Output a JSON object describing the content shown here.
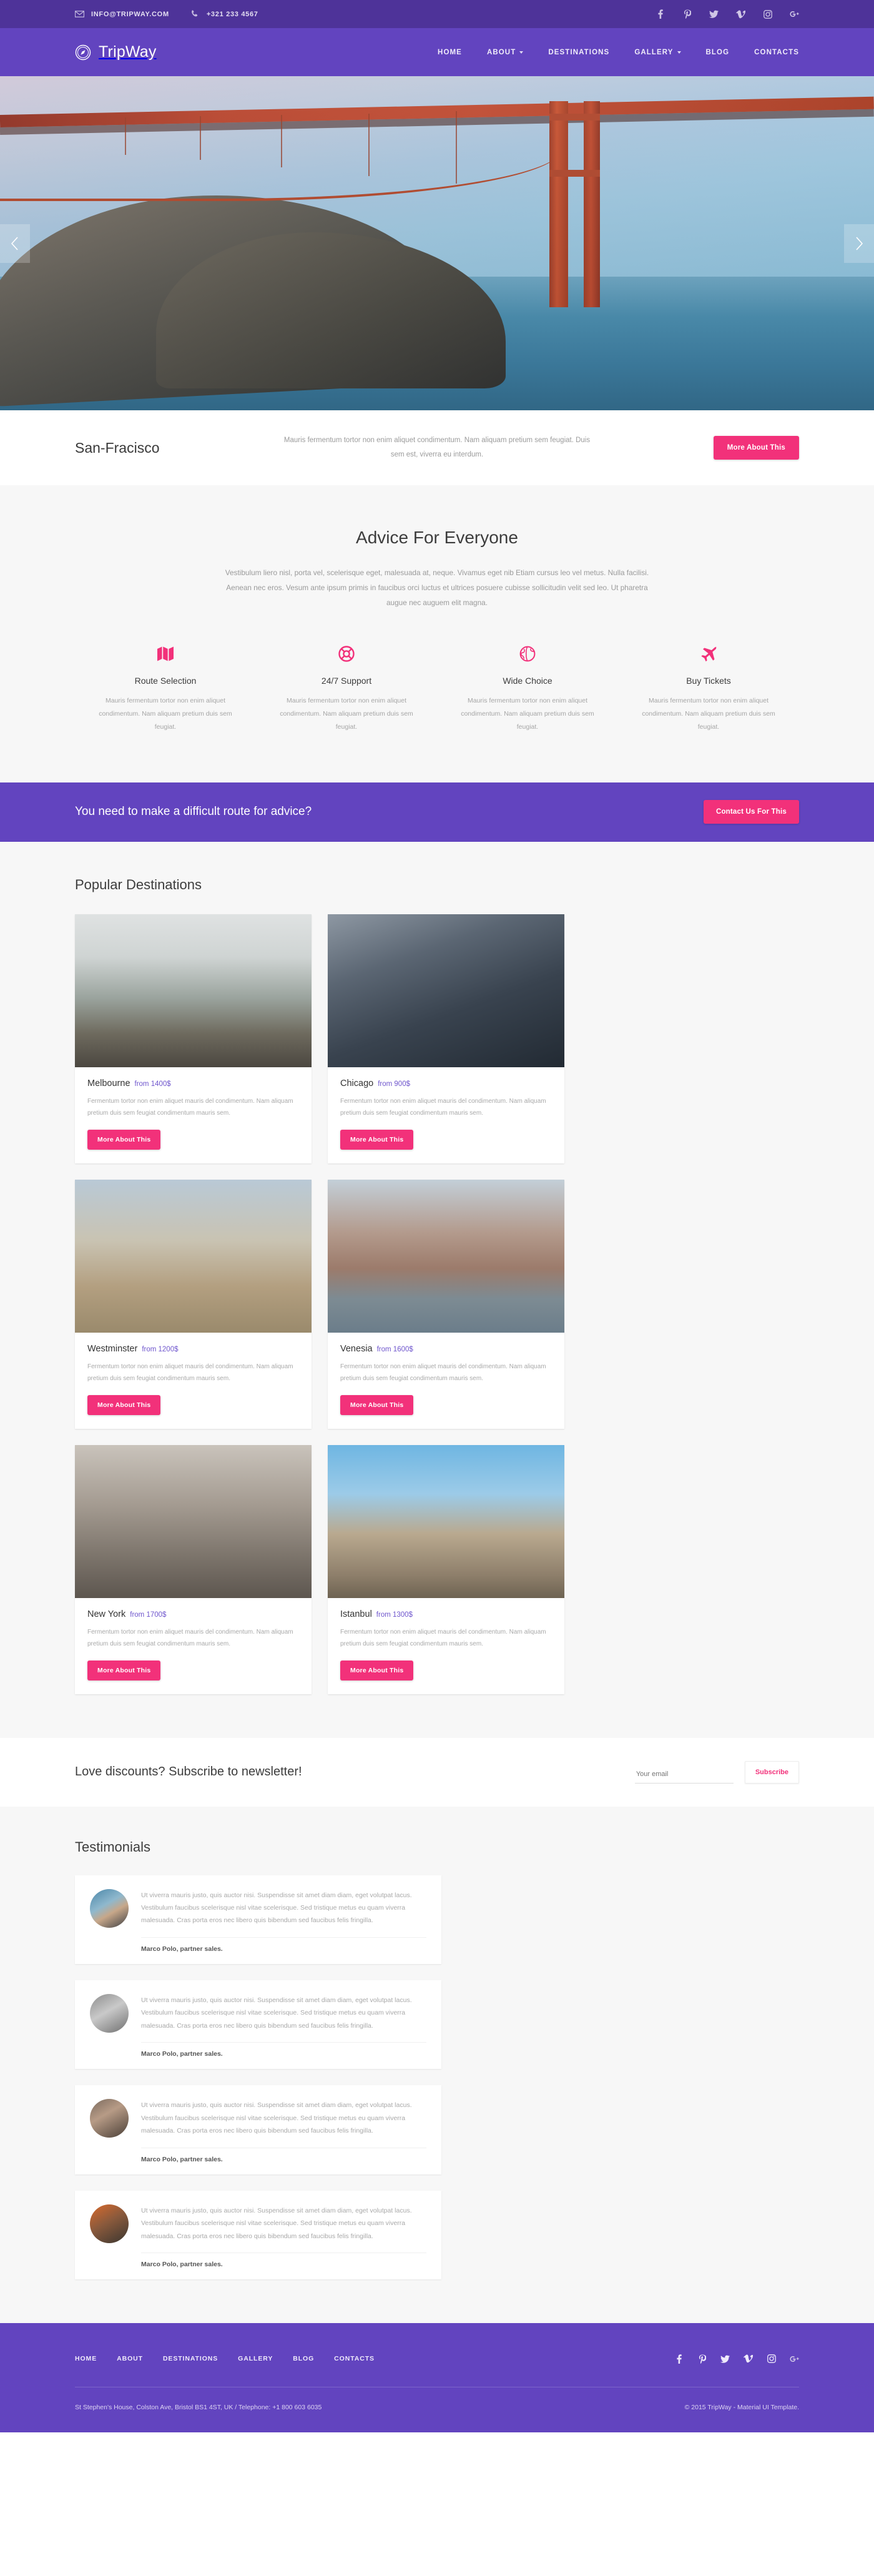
{
  "colors": {
    "purple_dark": "#4e3399",
    "purple": "#6244bf",
    "pink": "#f2317a",
    "price": "#6f56cd"
  },
  "topbar": {
    "email": "INFO@TRIPWAY.COM",
    "phone": "+321 233 4567",
    "socials": [
      "facebook",
      "pinterest",
      "twitter",
      "vimeo",
      "instagram",
      "google-plus"
    ]
  },
  "nav": {
    "brand": "TripWay",
    "items": [
      {
        "label": "HOME",
        "caret": false
      },
      {
        "label": "ABOUT",
        "caret": true
      },
      {
        "label": "DESTINATIONS",
        "caret": false
      },
      {
        "label": "GALLERY",
        "caret": true
      },
      {
        "label": "BLOG",
        "caret": false
      },
      {
        "label": "CONTACTS",
        "caret": false
      }
    ]
  },
  "hero": {
    "title": "San-Fracisco",
    "description": "Mauris fermentum tortor non enim aliquet condimentum. Nam aliquam pretium sem feugiat. Duis sem est, viverra eu interdum.",
    "button": "More About This",
    "prev": "previous-slide",
    "next": "next-slide"
  },
  "advice": {
    "title": "Advice For Everyone",
    "lead": "Vestibulum liero nisl, porta vel, scelerisque eget, malesuada at, neque. Vivamus eget nib Etiam cursus leo vel metus. Nulla facilisi. Aenean nec eros. Vesum ante ipsum primis in faucibus orci luctus et ultrices posuere cubisse sollicitudin velit sed leo. Ut pharetra augue nec auguem elit magna.",
    "features": [
      {
        "icon": "map-icon",
        "title": "Route Selection",
        "text": "Mauris fermentum tortor non enim aliquet condimentum. Nam aliquam pretium duis sem feugiat."
      },
      {
        "icon": "lifebuoy-icon",
        "title": "24/7 Support",
        "text": "Mauris fermentum tortor non enim aliquet condimentum. Nam aliquam pretium duis sem feugiat."
      },
      {
        "icon": "globe-icon",
        "title": "Wide Choice",
        "text": "Mauris fermentum tortor non enim aliquet condimentum. Nam aliquam pretium duis sem feugiat."
      },
      {
        "icon": "airplane-icon",
        "title": "Buy Tickets",
        "text": "Mauris fermentum tortor non enim aliquet condimentum. Nam aliquam pretium duis sem feugiat."
      }
    ]
  },
  "cta": {
    "text": "You need to make a difficult route for advice?",
    "button": "Contact Us For This"
  },
  "destinations": {
    "title": "Popular Destinations",
    "button_label": "More About This",
    "cards": [
      {
        "name": "Melbourne",
        "price": "from 1400$",
        "text": "Fermentum tortor non enim aliquet mauris del condimentum. Nam aliquam pretium duis sem feugiat condimentum mauris sem.",
        "image": "img-melbourne"
      },
      {
        "name": "Chicago",
        "price": "from 900$",
        "text": "Fermentum tortor non enim aliquet mauris del condimentum. Nam aliquam pretium duis sem feugiat condimentum mauris sem.",
        "image": "img-chicago"
      },
      {
        "name": "Westminster",
        "price": "from 1200$",
        "text": "Fermentum tortor non enim aliquet mauris del condimentum. Nam aliquam pretium duis sem feugiat condimentum mauris sem.",
        "image": "img-westminster"
      },
      {
        "name": "Venesia",
        "price": "from 1600$",
        "text": "Fermentum tortor non enim aliquet mauris del condimentum. Nam aliquam pretium duis sem feugiat condimentum mauris sem.",
        "image": "img-venesia"
      },
      {
        "name": "New York",
        "price": "from 1700$",
        "text": "Fermentum tortor non enim aliquet mauris del condimentum. Nam aliquam pretium duis sem feugiat condimentum mauris sem.",
        "image": "img-newyork"
      },
      {
        "name": "Istanbul",
        "price": "from 1300$",
        "text": "Fermentum tortor non enim aliquet mauris del condimentum. Nam aliquam pretium duis sem feugiat condimentum mauris sem.",
        "image": "img-istanbul"
      }
    ]
  },
  "subscribe": {
    "heading": "Love discounts? Subscribe to newsletter!",
    "placeholder": "Your email",
    "value": "",
    "button": "Subscribe"
  },
  "testimonials": {
    "title": "Testimonials",
    "items": [
      {
        "text": "Ut viverra mauris justo, quis auctor nisi. Suspendisse sit amet diam diam, eget volutpat lacus. Vestibulum faucibus scelerisque nisl vitae scelerisque. Sed tristique metus eu quam viverra malesuada. Cras porta eros nec libero quis bibendum sed faucibus felis fringilla.",
        "author": "Marco Polo, partner sales.",
        "avatar": "av1"
      },
      {
        "text": "Ut viverra mauris justo, quis auctor nisi. Suspendisse sit amet diam diam, eget volutpat lacus. Vestibulum faucibus scelerisque nisl vitae scelerisque. Sed tristique metus eu quam viverra malesuada. Cras porta eros nec libero quis bibendum sed faucibus felis fringilla.",
        "author": "Marco Polo, partner sales.",
        "avatar": "av2"
      },
      {
        "text": "Ut viverra mauris justo, quis auctor nisi. Suspendisse sit amet diam diam, eget volutpat lacus. Vestibulum faucibus scelerisque nisl vitae scelerisque. Sed tristique metus eu quam viverra malesuada. Cras porta eros nec libero quis bibendum sed faucibus felis fringilla.",
        "author": "Marco Polo, partner sales.",
        "avatar": "av3"
      },
      {
        "text": "Ut viverra mauris justo, quis auctor nisi. Suspendisse sit amet diam diam, eget volutpat lacus. Vestibulum faucibus scelerisque nisl vitae scelerisque. Sed tristique metus eu quam viverra malesuada. Cras porta eros nec libero quis bibendum sed faucibus felis fringilla.",
        "author": "Marco Polo, partner sales.",
        "avatar": "av4"
      }
    ]
  },
  "footer": {
    "menu": [
      "HOME",
      "ABOUT",
      "DESTINATIONS",
      "GALLERY",
      "BLOG",
      "CONTACTS"
    ],
    "socials": [
      "facebook",
      "pinterest",
      "twitter",
      "vimeo",
      "instagram",
      "google-plus"
    ],
    "address": "St Stephen's House, Colston Ave, Bristol BS1 4ST, UK  /  Telephone: +1 800 603 6035",
    "copyright": "© 2015 TripWay - Material UI Template."
  }
}
